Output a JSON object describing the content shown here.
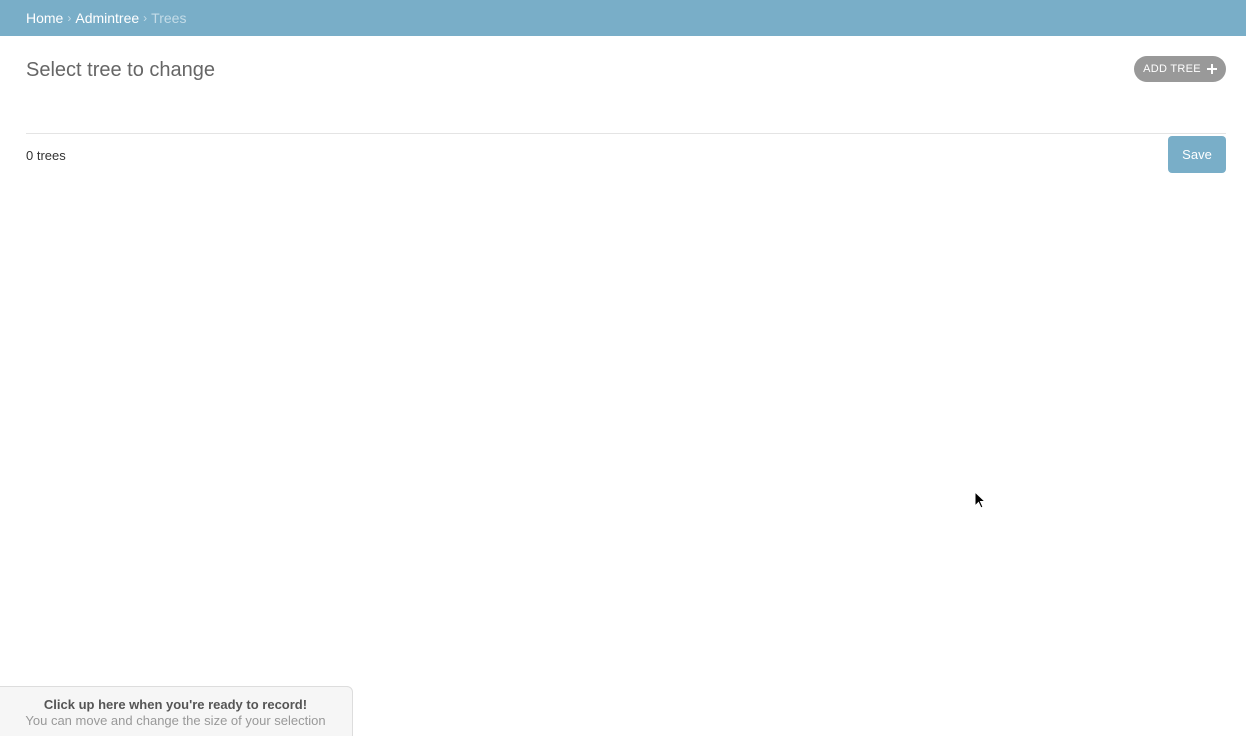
{
  "breadcrumbs": {
    "items": [
      {
        "label": "Home"
      },
      {
        "label": "Admintree"
      }
    ],
    "current": "Trees",
    "separator": "›"
  },
  "page": {
    "title": "Select tree to change",
    "add_button_label": "Add tree",
    "add_button_icon": "plus-icon"
  },
  "results": {
    "count_text": "0 trees",
    "save_label": "Save"
  },
  "recorder": {
    "title": "Click up here when you're ready to record!",
    "subtitle": "You can move and change the size of your selection"
  },
  "colors": {
    "header_bg": "#79aec8",
    "add_button_bg": "#999999",
    "save_button_bg": "#79aec8"
  }
}
